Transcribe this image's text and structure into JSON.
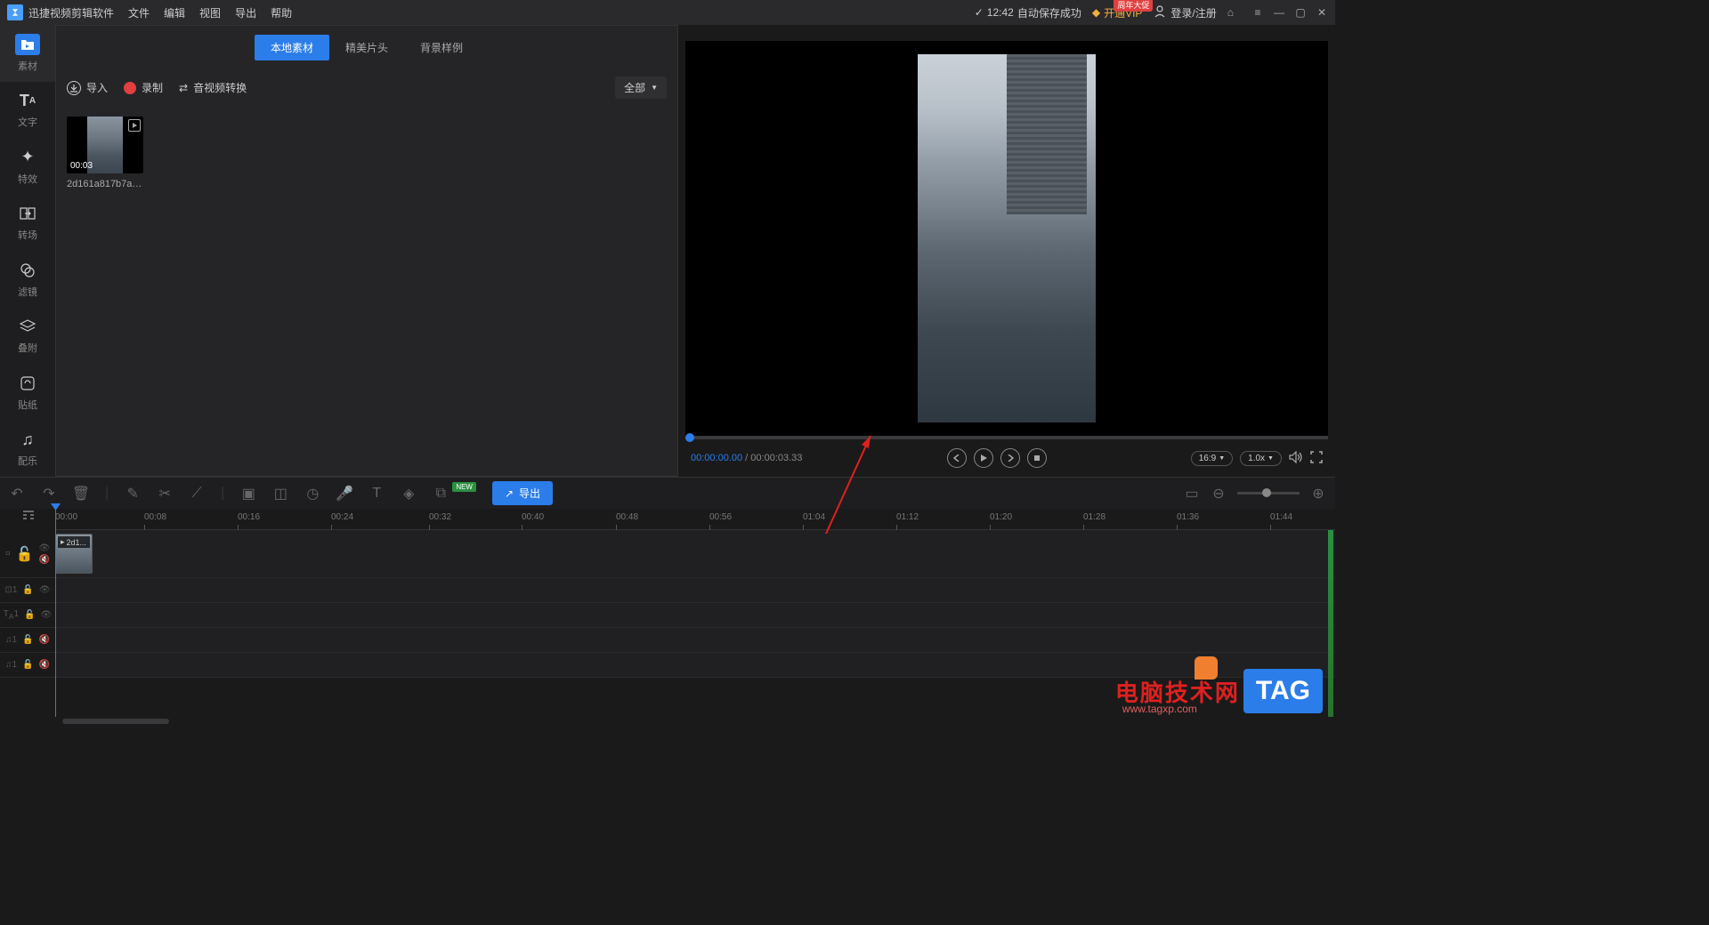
{
  "app": {
    "title": "迅捷视频剪辑软件"
  },
  "menu": [
    "文件",
    "编辑",
    "视图",
    "导出",
    "帮助"
  ],
  "titlebar_right": {
    "save_time": "12:42",
    "save_status": "自动保存成功",
    "vip_label": "开通VIP",
    "vip_badge": "周年大促",
    "login_label": "登录/注册"
  },
  "sidebar": [
    {
      "label": "素材",
      "icon": "folder-icon"
    },
    {
      "label": "文字",
      "icon": "text-icon"
    },
    {
      "label": "特效",
      "icon": "sparkle-icon"
    },
    {
      "label": "转场",
      "icon": "transition-icon"
    },
    {
      "label": "滤镜",
      "icon": "rings-icon"
    },
    {
      "label": "叠附",
      "icon": "layers-icon"
    },
    {
      "label": "贴纸",
      "icon": "link-icon"
    },
    {
      "label": "配乐",
      "icon": "music-icon"
    }
  ],
  "media_tabs": [
    "本地素材",
    "精美片头",
    "背景样例"
  ],
  "media_toolbar": {
    "import": "导入",
    "record": "录制",
    "convert": "音视频转换",
    "filter": "全部"
  },
  "clips": [
    {
      "duration": "00:03",
      "name": "2d161a817b7a2c..."
    }
  ],
  "preview": {
    "time_current": "00:00:00.00",
    "time_total": "00:00:03.33",
    "aspect": "16:9",
    "speed": "1.0x"
  },
  "timeline_toolbar": {
    "export": "导出",
    "new_badge": "NEW"
  },
  "ruler": [
    "00:00",
    "00:08",
    "00:16",
    "00:24",
    "00:32",
    "00:40",
    "00:48",
    "00:56",
    "01:04",
    "01:12",
    "01:20",
    "01:28",
    "01:36",
    "01:44"
  ],
  "timeline_clip": {
    "label": "2d1..."
  },
  "watermark": {
    "text": "电脑技术网",
    "tag": "TAG",
    "url": "www.tagxp.com"
  }
}
